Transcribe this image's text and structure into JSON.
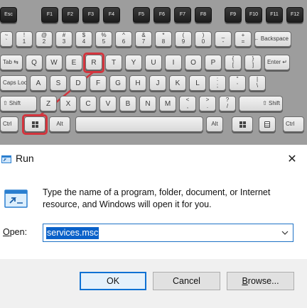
{
  "keyboard": {
    "rows": [
      [
        {
          "id": "esc",
          "label": "Esc",
          "fn": true
        },
        {
          "id": "f1",
          "label": "F1",
          "fn": true
        },
        {
          "id": "f2",
          "label": "F2",
          "fn": true
        },
        {
          "id": "f3",
          "label": "F3",
          "fn": true
        },
        {
          "id": "f4",
          "label": "F4",
          "fn": true
        },
        {
          "id": "f5",
          "label": "F5",
          "fn": true
        },
        {
          "id": "f6",
          "label": "F6",
          "fn": true
        },
        {
          "id": "f7",
          "label": "F7",
          "fn": true
        },
        {
          "id": "f8",
          "label": "F8",
          "fn": true
        },
        {
          "id": "f9",
          "label": "F9",
          "fn": true
        },
        {
          "id": "f10",
          "label": "F10",
          "fn": true
        },
        {
          "id": "f11",
          "label": "F11",
          "fn": true
        },
        {
          "id": "f12",
          "label": "F12",
          "fn": true
        }
      ],
      [
        {
          "id": "backtick",
          "label": "~\n`"
        },
        {
          "id": "1",
          "label": "!\n1"
        },
        {
          "id": "2",
          "label": "@\n2"
        },
        {
          "id": "3",
          "label": "#\n3"
        },
        {
          "id": "4",
          "label": "$\n4"
        },
        {
          "id": "5",
          "label": "%\n5"
        },
        {
          "id": "6",
          "label": "^\n6"
        },
        {
          "id": "7",
          "label": "&\n7"
        },
        {
          "id": "8",
          "label": "*\n8"
        },
        {
          "id": "9",
          "label": "(\n9"
        },
        {
          "id": "0",
          "label": ")\n0"
        },
        {
          "id": "minus",
          "label": "_\n-"
        },
        {
          "id": "equals",
          "label": "+\n="
        },
        {
          "id": "backspace",
          "label": "← Backspace"
        }
      ],
      [
        {
          "id": "tab",
          "label": "Tab ⇆"
        },
        {
          "id": "q",
          "label": "Q"
        },
        {
          "id": "w",
          "label": "W"
        },
        {
          "id": "e",
          "label": "E"
        },
        {
          "id": "r",
          "label": "R"
        },
        {
          "id": "t",
          "label": "T"
        },
        {
          "id": "y",
          "label": "Y"
        },
        {
          "id": "u",
          "label": "U"
        },
        {
          "id": "i",
          "label": "I"
        },
        {
          "id": "o",
          "label": "O"
        },
        {
          "id": "p",
          "label": "P"
        },
        {
          "id": "lbracket",
          "label": "{\n["
        },
        {
          "id": "rbracket",
          "label": "}\n]"
        },
        {
          "id": "enter",
          "label": "Enter ↵"
        }
      ],
      [
        {
          "id": "capslock",
          "label": "Caps Lock"
        },
        {
          "id": "a",
          "label": "A"
        },
        {
          "id": "s",
          "label": "S"
        },
        {
          "id": "d",
          "label": "D"
        },
        {
          "id": "f",
          "label": "F"
        },
        {
          "id": "g",
          "label": "G"
        },
        {
          "id": "h",
          "label": "H"
        },
        {
          "id": "j",
          "label": "J"
        },
        {
          "id": "k",
          "label": "K"
        },
        {
          "id": "l",
          "label": "L"
        },
        {
          "id": "semicolon",
          "label": ":\n;"
        },
        {
          "id": "quote",
          "label": "\"\n'"
        },
        {
          "id": "backslash",
          "label": "|\n\\"
        }
      ],
      [
        {
          "id": "lshift",
          "label": "⇧ Shift"
        },
        {
          "id": "z",
          "label": "Z"
        },
        {
          "id": "x",
          "label": "X"
        },
        {
          "id": "c",
          "label": "C"
        },
        {
          "id": "v",
          "label": "V"
        },
        {
          "id": "b",
          "label": "B"
        },
        {
          "id": "n",
          "label": "N"
        },
        {
          "id": "m",
          "label": "M"
        },
        {
          "id": "comma",
          "label": "<\n,"
        },
        {
          "id": "period",
          "label": ">\n."
        },
        {
          "id": "slash",
          "label": "?\n/"
        },
        {
          "id": "rshift",
          "label": "⇧ Shift"
        }
      ],
      [
        {
          "id": "lctrl",
          "label": "Ctrl"
        },
        {
          "id": "lwin",
          "label": "",
          "icon": "windows-logo-icon"
        },
        {
          "id": "lalt",
          "label": "Alt"
        },
        {
          "id": "space",
          "label": ""
        },
        {
          "id": "ralt",
          "label": "Alt"
        },
        {
          "id": "rwin",
          "label": "",
          "icon": "windows-logo-icon"
        },
        {
          "id": "menu",
          "label": "",
          "icon": "context-menu-icon"
        },
        {
          "id": "rctrl",
          "label": "Ctrl"
        }
      ]
    ],
    "highlighted_keys": [
      "r",
      "lwin"
    ],
    "highlight_color": "#d3343d"
  },
  "dialog": {
    "title": "Run",
    "title_icon": "run-app-icon",
    "close_glyph": "✕",
    "description": "Type the name of a program, folder, document, or Internet resource, and Windows will open it for you.",
    "open_label_access_key": "O",
    "open_label_rest": "pen:",
    "open_value": "services.msc",
    "dropdown_icon": "chevron-down-icon",
    "buttons": {
      "ok": "OK",
      "cancel": "Cancel",
      "browse_access_key": "B",
      "browse_rest": "rowse..."
    },
    "accent_color": "#0f71d3",
    "selection_color": "#0a61c9"
  }
}
